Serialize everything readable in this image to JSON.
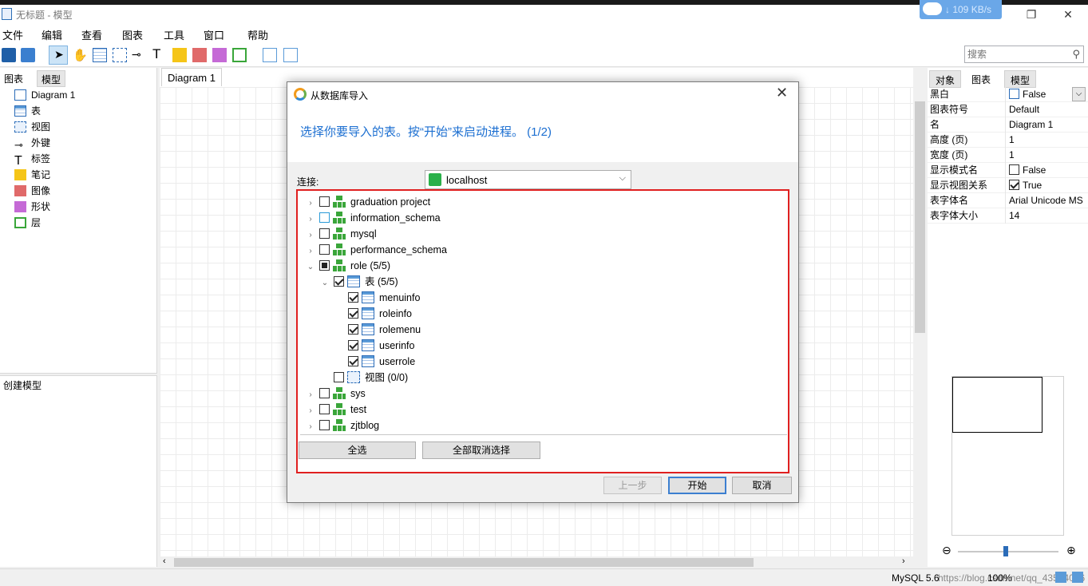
{
  "window": {
    "title": "无标题 - 模型",
    "net_speed": "↓ 109 KB/s"
  },
  "menu": [
    "文件",
    "编辑",
    "查看",
    "图表",
    "工具",
    "窗口",
    "帮助"
  ],
  "search": {
    "placeholder": "搜索"
  },
  "left_panel": {
    "tabs": [
      "图表",
      "模型"
    ],
    "items": [
      "Diagram 1",
      "表",
      "视图",
      "外键",
      "标签",
      "笔记",
      "图像",
      "形状",
      "层"
    ],
    "bottom_title": "创建模型"
  },
  "canvas": {
    "tab": "Diagram 1"
  },
  "right_panel": {
    "tabs": [
      "对象",
      "图表",
      "模型"
    ],
    "properties": [
      {
        "key": "黑白",
        "value": "False",
        "checkbox": false,
        "dropdown": true
      },
      {
        "key": "图表符号",
        "value": "Default"
      },
      {
        "key": "名",
        "value": "Diagram 1"
      },
      {
        "key": "高度 (页)",
        "value": "1"
      },
      {
        "key": "宽度 (页)",
        "value": "1"
      },
      {
        "key": "显示模式名",
        "value": "False",
        "checkbox": false
      },
      {
        "key": "显示视图关系",
        "value": "True",
        "checkbox": true
      },
      {
        "key": "表字体名",
        "value": "Arial Unicode MS"
      },
      {
        "key": "表字体大小",
        "value": "14"
      }
    ]
  },
  "status": {
    "db": "MySQL 5.6",
    "zoom": "100%",
    "watermark": "https://blog.csdn.net/qq_43584016"
  },
  "dialog": {
    "title": "从数据库导入",
    "heading": "选择你要导入的表。按“开始”来启动进程。 (1/2)",
    "connection_label": "连接:",
    "connection_value": "localhost",
    "tree": [
      {
        "label": "graduation project",
        "level": 0,
        "arrow": "›",
        "state": "off",
        "icon": "db"
      },
      {
        "label": "information_schema",
        "level": 0,
        "arrow": "›",
        "state": "off",
        "icon": "db"
      },
      {
        "label": "mysql",
        "level": 0,
        "arrow": "›",
        "state": "off",
        "icon": "db"
      },
      {
        "label": "performance_schema",
        "level": 0,
        "arrow": "›",
        "state": "off",
        "icon": "db"
      },
      {
        "label": "role (5/5)",
        "level": 0,
        "arrow": "⌄",
        "state": "partial",
        "icon": "db"
      },
      {
        "label": "表 (5/5)",
        "level": 1,
        "arrow": "⌄",
        "state": "on",
        "icon": "table"
      },
      {
        "label": "menuinfo",
        "level": 2,
        "arrow": "",
        "state": "on",
        "icon": "table"
      },
      {
        "label": "roleinfo",
        "level": 2,
        "arrow": "",
        "state": "on",
        "icon": "table"
      },
      {
        "label": "rolemenu",
        "level": 2,
        "arrow": "",
        "state": "on",
        "icon": "table"
      },
      {
        "label": "userinfo",
        "level": 2,
        "arrow": "",
        "state": "on",
        "icon": "table"
      },
      {
        "label": "userrole",
        "level": 2,
        "arrow": "",
        "state": "on",
        "icon": "table"
      },
      {
        "label": "视图 (0/0)",
        "level": 1,
        "arrow": "",
        "state": "off",
        "icon": "view"
      },
      {
        "label": "sys",
        "level": 0,
        "arrow": "›",
        "state": "off",
        "icon": "db"
      },
      {
        "label": "test",
        "level": 0,
        "arrow": "›",
        "state": "off",
        "icon": "db"
      },
      {
        "label": "zjtblog",
        "level": 0,
        "arrow": "›",
        "state": "off",
        "icon": "db"
      }
    ],
    "select_all": "全选",
    "deselect_all": "全部取消选择",
    "prev": "上一步",
    "start": "开始",
    "cancel": "取消"
  },
  "colors": {
    "heading": "#1c6fd1",
    "highlight_border": "#e02020",
    "db_icon": "#3aa63a"
  }
}
